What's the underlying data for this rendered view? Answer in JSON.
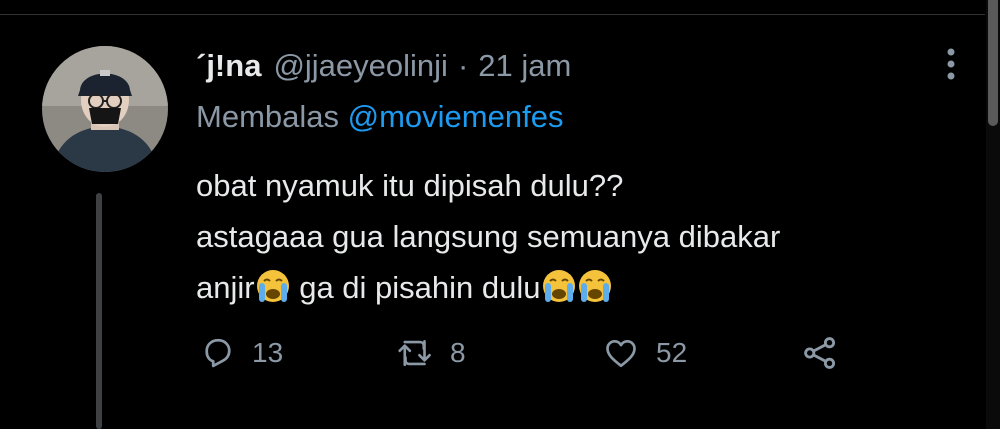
{
  "tweet": {
    "display_name": "´j!na",
    "handle": "@jjaeyeolinji",
    "separator": "·",
    "time": "21 jam",
    "reply_prefix": "Membalas",
    "reply_mention": "@moviemenfes",
    "text": {
      "line1": "obat nyamuk itu dipisah dulu??",
      "line2": "astagaaa gua langsung semuanya dibakar",
      "line3_a": "anjir",
      "line3_b": " ga di pisahin dulu"
    },
    "emoji": "loudly-crying-face"
  },
  "actions": {
    "reply_count": "13",
    "retweet_count": "8",
    "like_count": "52"
  },
  "colors": {
    "background": "#000000",
    "text": "#e7e9ea",
    "secondary": "#8b98a5",
    "accent": "#1d9bf0"
  }
}
